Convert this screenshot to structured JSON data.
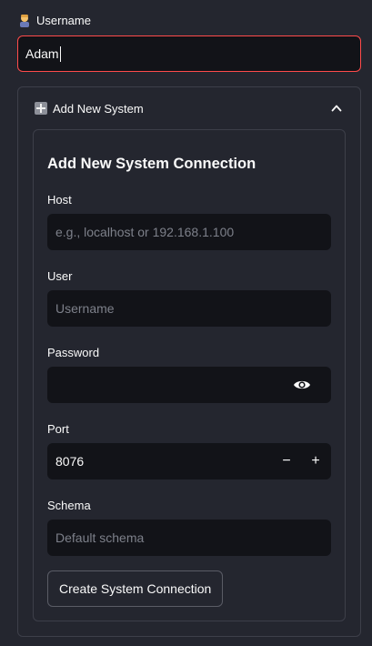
{
  "username": {
    "icon": "person-emoji-icon",
    "label": "Username",
    "value": "Adam"
  },
  "expander": {
    "icon": "plus-icon",
    "title": "Add New System",
    "toggle_icon": "chevron-up-icon",
    "expanded": true
  },
  "form": {
    "title": "Add New System Connection",
    "host": {
      "label": "Host",
      "placeholder": "e.g., localhost or 192.168.1.100"
    },
    "user": {
      "label": "User",
      "placeholder": "Username"
    },
    "password": {
      "label": "Password",
      "value": "",
      "toggle_icon": "eye-icon"
    },
    "port": {
      "label": "Port",
      "value": "8076",
      "decrement": "−",
      "increment": "+"
    },
    "schema": {
      "label": "Schema",
      "placeholder": "Default schema"
    },
    "submit_label": "Create System Connection"
  },
  "colors": {
    "background": "#24262f",
    "input_bg": "#121318",
    "focus_border": "#ff4b4b",
    "border": "#3d3f49",
    "placeholder": "#7d808a",
    "text": "#fafafa"
  }
}
